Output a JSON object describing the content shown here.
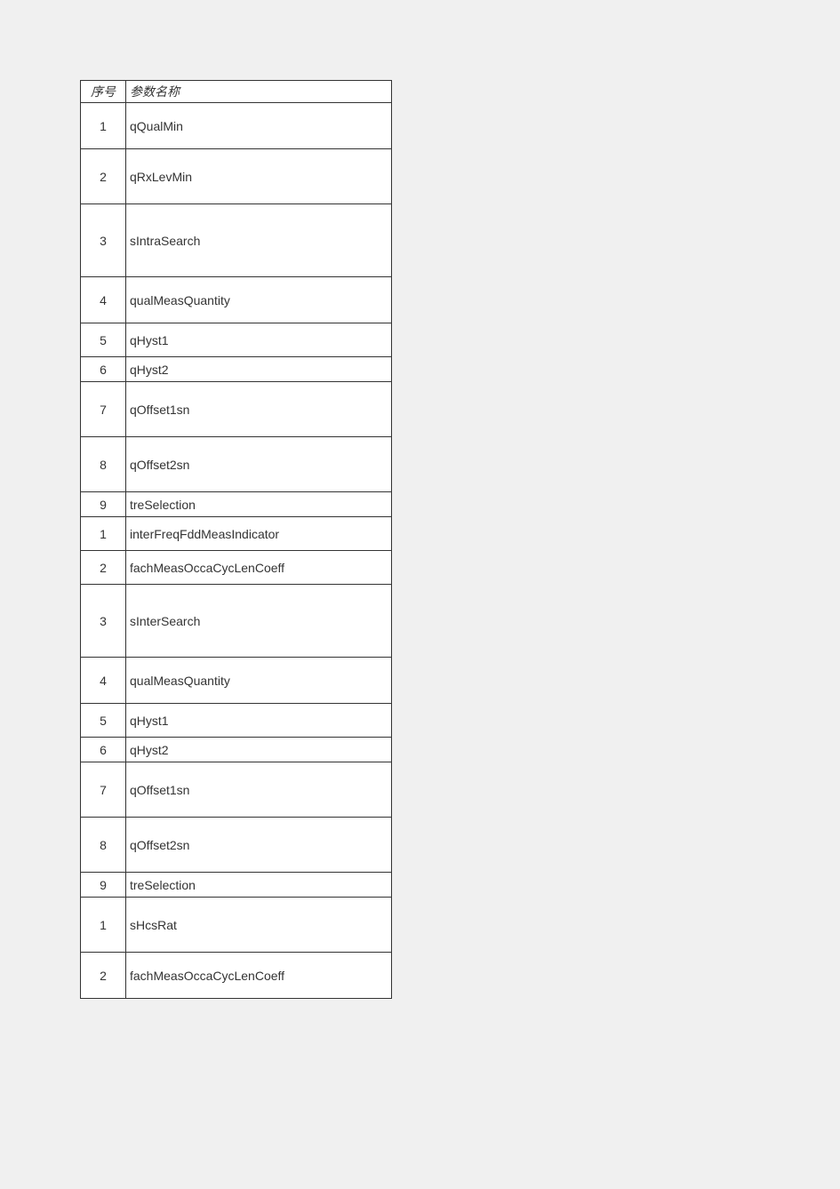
{
  "table": {
    "headers": {
      "seq": "序号",
      "name": "参数名称"
    },
    "rows": [
      {
        "seq": "1",
        "name": "qQualMin",
        "h": "h-med"
      },
      {
        "seq": "2",
        "name": "qRxLevMin",
        "h": "h-tall"
      },
      {
        "seq": "3",
        "name": "sIntraSearch",
        "h": "h-vtall"
      },
      {
        "seq": "4",
        "name": "qualMeasQuantity",
        "h": "h-med"
      },
      {
        "seq": "5",
        "name": "qHyst1",
        "h": "h-norm"
      },
      {
        "seq": "6",
        "name": "qHyst2",
        "h": "h-short"
      },
      {
        "seq": "7",
        "name": "qOffset1sn",
        "h": "h-tall"
      },
      {
        "seq": "8",
        "name": "qOffset2sn",
        "h": "h-tall"
      },
      {
        "seq": "9",
        "name": "treSelection",
        "h": "h-short"
      },
      {
        "seq": "1",
        "name": "interFreqFddMeasIndicator",
        "h": "h-norm"
      },
      {
        "seq": "2",
        "name": "fachMeasOccaCycLenCoeff",
        "h": "h-norm"
      },
      {
        "seq": "3",
        "name": "sInterSearch",
        "h": "h-vtall"
      },
      {
        "seq": "4",
        "name": "qualMeasQuantity",
        "h": "h-med"
      },
      {
        "seq": "5",
        "name": "qHyst1",
        "h": "h-norm"
      },
      {
        "seq": "6",
        "name": "qHyst2",
        "h": "h-short"
      },
      {
        "seq": "7",
        "name": "qOffset1sn",
        "h": "h-tall"
      },
      {
        "seq": "8",
        "name": "qOffset2sn",
        "h": "h-tall"
      },
      {
        "seq": "9",
        "name": "treSelection",
        "h": "h-short"
      },
      {
        "seq": "1",
        "name": "sHcsRat",
        "h": "h-tall"
      },
      {
        "seq": "2",
        "name": "fachMeasOccaCycLenCoeff",
        "h": "h-med"
      }
    ]
  }
}
